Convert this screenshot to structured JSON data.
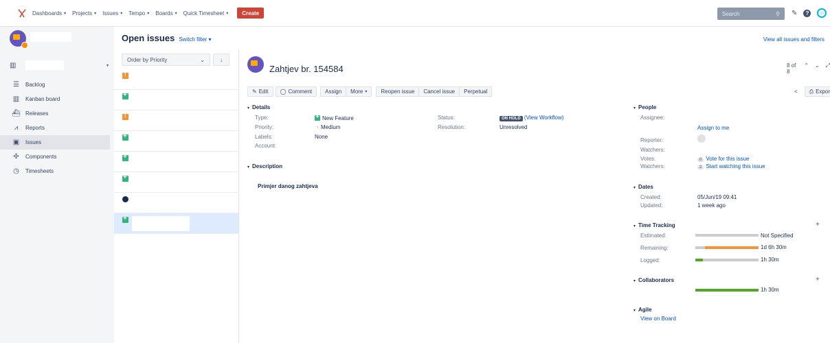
{
  "nav": {
    "items": [
      {
        "label": "Dashboards",
        "dropdown": true
      },
      {
        "label": "Projects",
        "dropdown": true
      },
      {
        "label": "Issues",
        "dropdown": true
      },
      {
        "label": "Tempo",
        "dropdown": true
      },
      {
        "label": "Boards",
        "dropdown": true
      },
      {
        "label": "Quick Timesheet",
        "dropdown": true
      }
    ],
    "create_label": "Create",
    "search_placeholder": "Search"
  },
  "sidebar": {
    "items": [
      {
        "label": "Backlog",
        "icon": "backlog-icon"
      },
      {
        "label": "Kanban board",
        "icon": "board-icon"
      },
      {
        "label": "Releases",
        "icon": "ship-icon"
      },
      {
        "label": "Reports",
        "icon": "chart-icon"
      },
      {
        "label": "Issues",
        "icon": "issues-icon",
        "active": true
      },
      {
        "label": "Components",
        "icon": "puzzle-icon"
      },
      {
        "label": "Timesheets",
        "icon": "clock-icon"
      }
    ]
  },
  "list": {
    "title": "Open issues",
    "switch_filter": "Switch filter",
    "view_all": "View all issues and filters",
    "order_by": "Order by Priority",
    "rows": [
      {
        "type": "improvement"
      },
      {
        "type": "feature"
      },
      {
        "type": "improvement"
      },
      {
        "type": "feature"
      },
      {
        "type": "feature"
      },
      {
        "type": "feature"
      },
      {
        "type": "bug"
      },
      {
        "type": "feature",
        "selected": true
      }
    ]
  },
  "issue": {
    "title": "Zahtjev br. 154584",
    "pager": "8 of 8",
    "toolbar": {
      "edit": "Edit",
      "comment": "Comment",
      "assign": "Assign",
      "more": "More",
      "reopen": "Reopen issue",
      "cancel": "Cancel issue",
      "perpetual": "Perpetual",
      "export": "Export"
    },
    "details": {
      "heading": "Details",
      "type_label": "Type:",
      "type_value": "New Feature",
      "priority_label": "Priority:",
      "priority_value": "Medium",
      "labels_label": "Labels:",
      "labels_value": "None",
      "account_label": "Account:",
      "status_label": "Status:",
      "status_badge": "ON HOLD",
      "status_workflow": "(View Workflow)",
      "resolution_label": "Resolution:",
      "resolution_value": "Unresolved"
    },
    "description": {
      "heading": "Description",
      "text": "Primjer danog zahtjeva"
    },
    "people": {
      "heading": "People",
      "assignee_label": "Assignee:",
      "assign_to_me": "Assign to me",
      "reporter_label": "Reporter:",
      "watchers_label": "Watchers:",
      "votes_label": "Votes:",
      "votes_count": "0",
      "vote_link": "Vote for this issue",
      "watchers2_label": "Watchers:",
      "watchers_count": "2",
      "watch_link": "Start watching this issue"
    },
    "dates": {
      "heading": "Dates",
      "created_label": "Created:",
      "created_value": "05/Jun/19 09:41",
      "updated_label": "Updated:",
      "updated_value": "1 week ago"
    },
    "time_tracking": {
      "heading": "Time Tracking",
      "estimated_label": "Estimated:",
      "estimated_value": "Not Specified",
      "remaining_label": "Remaining:",
      "remaining_value": "1d 6h 30m",
      "remaining_fraction": 0.85,
      "logged_label": "Logged:",
      "logged_value": "1h 30m",
      "logged_fraction": 0.12
    },
    "collaborators": {
      "heading": "Collaborators",
      "value": "1h 30m"
    },
    "agile": {
      "heading": "Agile",
      "link": "View on Board"
    }
  },
  "colors": {
    "create": "#d04437",
    "remaining": "#f79232",
    "logged": "#51a825"
  }
}
